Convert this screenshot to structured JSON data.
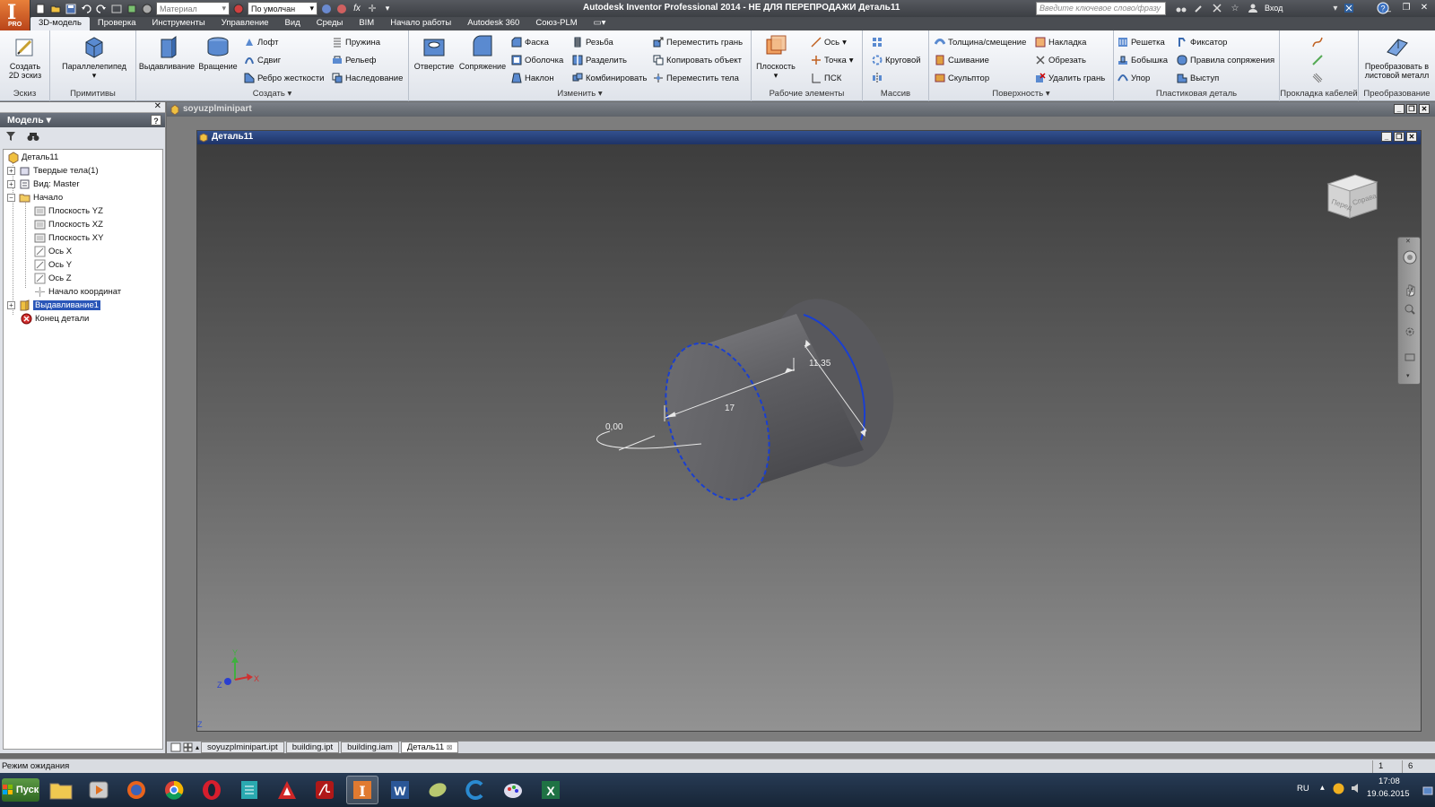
{
  "titlebar": {
    "logo_letter": "I",
    "logo_sub": "PRO",
    "material_placeholder": "Материал",
    "appearance_value": "По умолчан",
    "title": "Autodesk Inventor Professional 2014 - НЕ ДЛЯ ПЕРЕПРОДАЖИ   Деталь11",
    "search_placeholder": "Введите ключевое слово/фразу",
    "login": "Вход"
  },
  "menu_tabs": [
    "3D-модель",
    "Проверка",
    "Инструменты",
    "Управление",
    "Вид",
    "Среды",
    "BIM",
    "Начало работы",
    "Autodesk 360",
    "Союз-PLM"
  ],
  "ribbon": {
    "sketch": {
      "create_2d": "Создать 2D эскиз",
      "label": "Эскиз"
    },
    "primitives": {
      "box": "Параллелепипед",
      "label": "Примитивы"
    },
    "create": {
      "extrude": "Выдавливание",
      "revolve": "Вращение",
      "loft": "Лофт",
      "sweep": "Сдвиг",
      "rib": "Ребро жесткости",
      "coil": "Пружина",
      "emboss": "Рельеф",
      "derive": "Наследование",
      "label": "Создать"
    },
    "modify": {
      "hole": "Отверстие",
      "fillet": "Сопряжение",
      "chamfer": "Фаска",
      "shell": "Оболочка",
      "draft": "Наклон",
      "thread": "Резьба",
      "split": "Разделить",
      "combine": "Комбинировать",
      "move_face": "Переместить грань",
      "copy_object": "Копировать объект",
      "move_bodies": "Переместить тела",
      "label": "Изменить"
    },
    "work_features": {
      "plane": "Плоскость",
      "axis": "Ось",
      "point": "Точка",
      "ucs": "ПСК",
      "label": "Рабочие элементы"
    },
    "pattern": {
      "circular": "Круговой",
      "label": "Массив"
    },
    "surface": {
      "thicken": "Толщина/смещение",
      "stitch": "Сшивание",
      "sculpt": "Скульптор",
      "patch": "Накладка",
      "trim": "Обрезать",
      "delete_face": "Удалить грань",
      "label": "Поверхность"
    },
    "plastic": {
      "grill": "Решетка",
      "boss": "Бобышка",
      "rest": "Упор",
      "snap_fit": "Фиксатор",
      "rule_fillet": "Правила сопряжения",
      "lip": "Выступ",
      "label": "Пластиковая деталь"
    },
    "harness": {
      "label": "Прокладка кабелей"
    },
    "convert": {
      "to_sheet_metal": "Преобразовать в листовой металл",
      "label": "Преобразование"
    }
  },
  "browser": {
    "title": "Модель",
    "tree": [
      {
        "label": "Деталь11"
      },
      {
        "label": "Твердые тела(1)"
      },
      {
        "label": "Вид: Master"
      },
      {
        "label": "Начало"
      },
      {
        "label": "Плоскость YZ"
      },
      {
        "label": "Плоскость XZ"
      },
      {
        "label": "Плоскость XY"
      },
      {
        "label": "Ось X"
      },
      {
        "label": "Ось Y"
      },
      {
        "label": "Ось Z"
      },
      {
        "label": "Начало координат"
      },
      {
        "label": "Выдавливание1"
      },
      {
        "label": "Конец детали"
      }
    ]
  },
  "outer_window": {
    "title": "soyuzplminipart"
  },
  "document_window": {
    "title": "Деталь11"
  },
  "viewport": {
    "dim_angle": "0,00",
    "dim_length": "17",
    "dim_diameter": "11,35",
    "triad_x": "X",
    "triad_y": "Y",
    "triad_z": "Z",
    "corner_z": "Z",
    "viewcube_front": "Перед",
    "viewcube_right": "Справа",
    "highlight_color": "#1a3fd0"
  },
  "doc_tabs": [
    "soyuzplminipart.ipt",
    "building.ipt",
    "building.iam",
    "Деталь11"
  ],
  "status": {
    "text": "Режим ожидания",
    "count1": "1",
    "count2": "6"
  },
  "taskbar": {
    "start": "Пуск",
    "apps": [
      "explorer-icon",
      "media-player-icon",
      "firefox-icon",
      "chrome-icon",
      "opera-icon",
      "sheet-app-icon",
      "autocad-icon",
      "acrobat-icon",
      "inventor-icon",
      "word-icon",
      "leaf-app-icon",
      "c-app-icon",
      "paint-icon",
      "excel-icon"
    ],
    "lang": "RU",
    "time": "17:08",
    "date": "19.06.2015"
  },
  "colors": {
    "accent": "#e8803a",
    "selection": "#2a56b8",
    "titlebar": "#3c3f44"
  }
}
